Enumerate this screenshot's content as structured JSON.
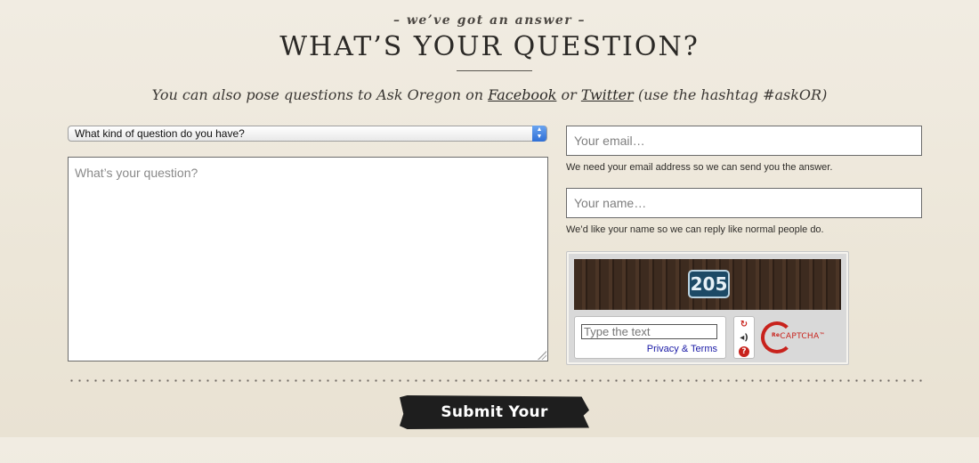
{
  "header": {
    "eyebrow": "– we’ve got an answer –",
    "title": "WHAT’S YOUR QUESTION?",
    "subtitle_prefix": "You can also pose questions to Ask Oregon on ",
    "facebook_link": "Facebook",
    "subtitle_or": " or ",
    "twitter_link": "Twitter",
    "subtitle_suffix": " (use the hashtag #askOR)"
  },
  "form": {
    "question_type_select": {
      "selected": "What kind of question do you have?"
    },
    "question_textarea": {
      "placeholder": "What’s your question?"
    },
    "email": {
      "placeholder": "Your email…",
      "help": "We need your email address so we can send you the answer."
    },
    "name": {
      "placeholder": "Your name…",
      "help": "We’d like your name so we can reply like normal people do."
    },
    "submit_label": "Submit Your Question"
  },
  "captcha": {
    "image_text": "205",
    "input_placeholder": "Type the text",
    "links": "Privacy & Terms",
    "logo_prefix": "Re",
    "logo_word": "CAPTCHA",
    "logo_tm": "™",
    "icons": [
      "refresh-icon",
      "audio-icon",
      "help-icon"
    ]
  },
  "colors": {
    "background": "#efe9de",
    "text": "#2b2926",
    "submit_bg": "#1e1e1e",
    "recaptcha_red": "#c8221c"
  }
}
